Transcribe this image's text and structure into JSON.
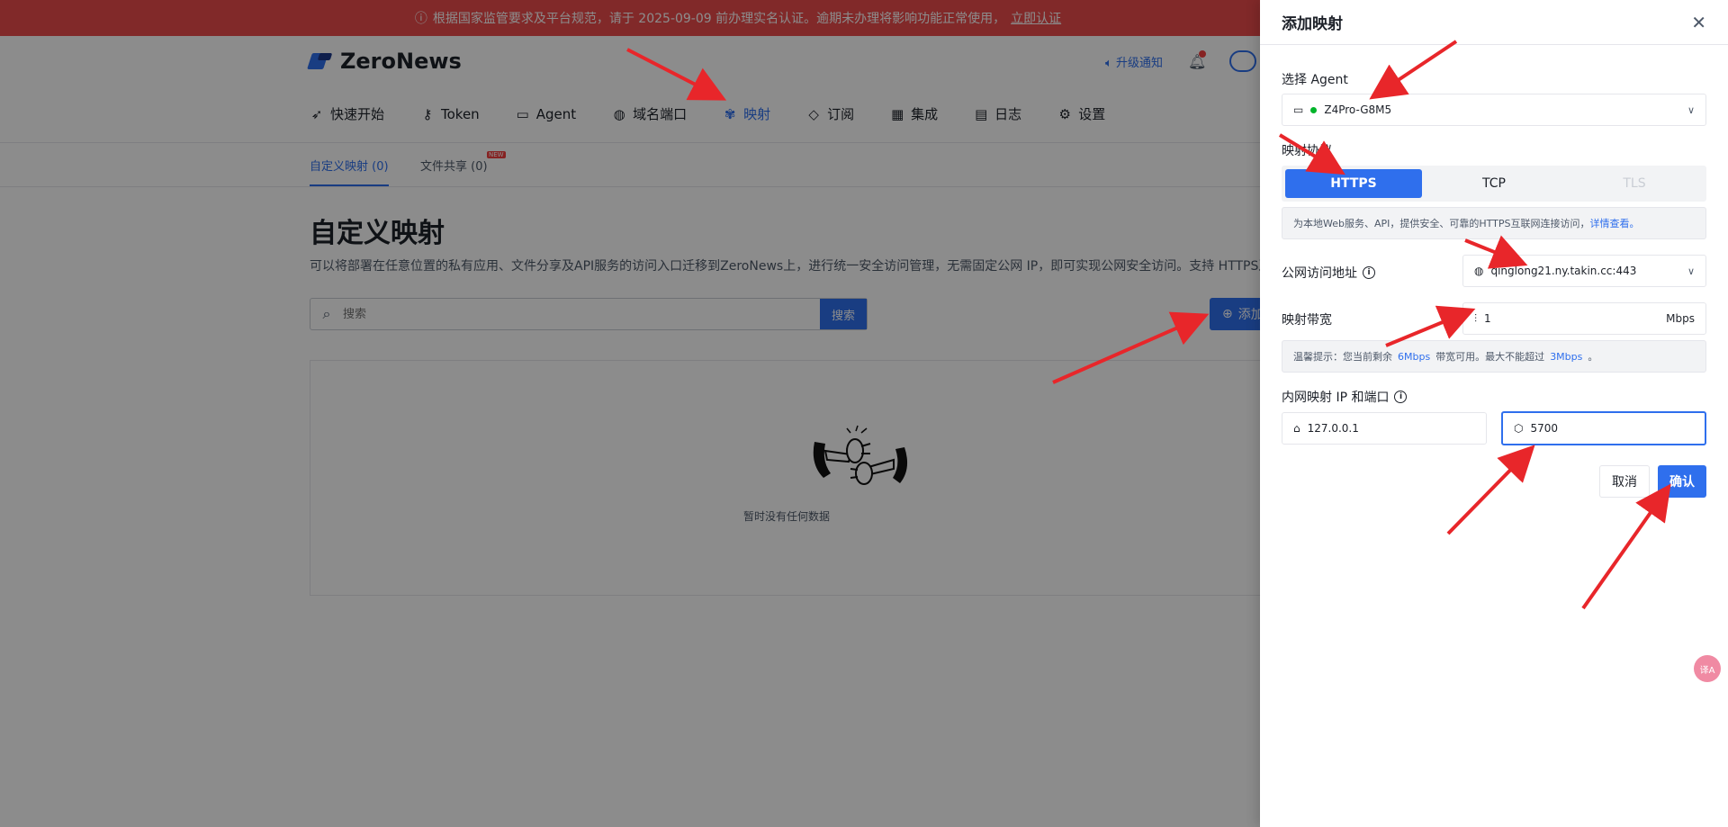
{
  "notice": {
    "text": "根据国家监管要求及平台规范，请于 2025-09-09 前办理实名认证。逾期未办理将影响功能正常使用，",
    "link": "立即认证"
  },
  "header": {
    "brand": "ZeroNews",
    "upgrade_notice": "升级通知"
  },
  "nav": [
    {
      "label": "快速开始",
      "icon": "rocket-icon"
    },
    {
      "label": "Token",
      "icon": "key-icon"
    },
    {
      "label": "Agent",
      "icon": "laptop-icon"
    },
    {
      "label": "域名端口",
      "icon": "globe-icon"
    },
    {
      "label": "映射",
      "icon": "mapping-icon",
      "active": true
    },
    {
      "label": "订阅",
      "icon": "diamond-icon"
    },
    {
      "label": "集成",
      "icon": "apps-icon"
    },
    {
      "label": "日志",
      "icon": "document-icon"
    },
    {
      "label": "设置",
      "icon": "gear-icon"
    }
  ],
  "subtabs": {
    "custom": "自定义映射 (0)",
    "file_share": "文件共享 (0)",
    "new_badge": "NEW"
  },
  "main": {
    "title": "自定义映射",
    "description": "可以将部署在任意位置的私有应用、文件分享及API服务的访问入口迁移到ZeroNews上，进行统一安全访问管理，无需固定公网 IP，即可实现公网安全访问。支持 HTTPS及",
    "search_placeholder": "搜索",
    "search_button": "搜索",
    "add_button": "添加",
    "empty_text": "暂时没有任何数据"
  },
  "drawer": {
    "title": "添加映射",
    "agent_label": "选择 Agent",
    "agent_value": "Z4Pro-G8M5",
    "protocol_label": "映射协议",
    "protocols": [
      "HTTPS",
      "TCP",
      "TLS"
    ],
    "protocol_selected": "HTTPS",
    "protocol_tip": "为本地Web服务、API，提供安全、可靠的HTTPS互联网连接访问，",
    "protocol_tip_link": "详情查看。",
    "public_addr_label": "公网访问地址",
    "public_addr_value": "qinglong21.ny.takin.cc:443",
    "bandwidth_label": "映射带宽",
    "bandwidth_value": "1",
    "bandwidth_unit": "Mbps",
    "bandwidth_tip_prefix": "温馨提示：您当前剩余",
    "bandwidth_remaining": "6Mbps",
    "bandwidth_tip_mid": "带宽可用。最大不能超过",
    "bandwidth_max": "3Mbps",
    "bandwidth_tip_suffix": "。",
    "internal_label": "内网映射 IP 和端口",
    "internal_ip": "127.0.0.1",
    "internal_port": "5700",
    "cancel": "取消",
    "confirm": "确认"
  },
  "floating": {
    "translate": "译A"
  },
  "colors": {
    "accent": "#2f6fed",
    "notice_bg": "#ec4b4b",
    "status_online": "#00b42a",
    "annotation_arrow": "#e8262a"
  }
}
